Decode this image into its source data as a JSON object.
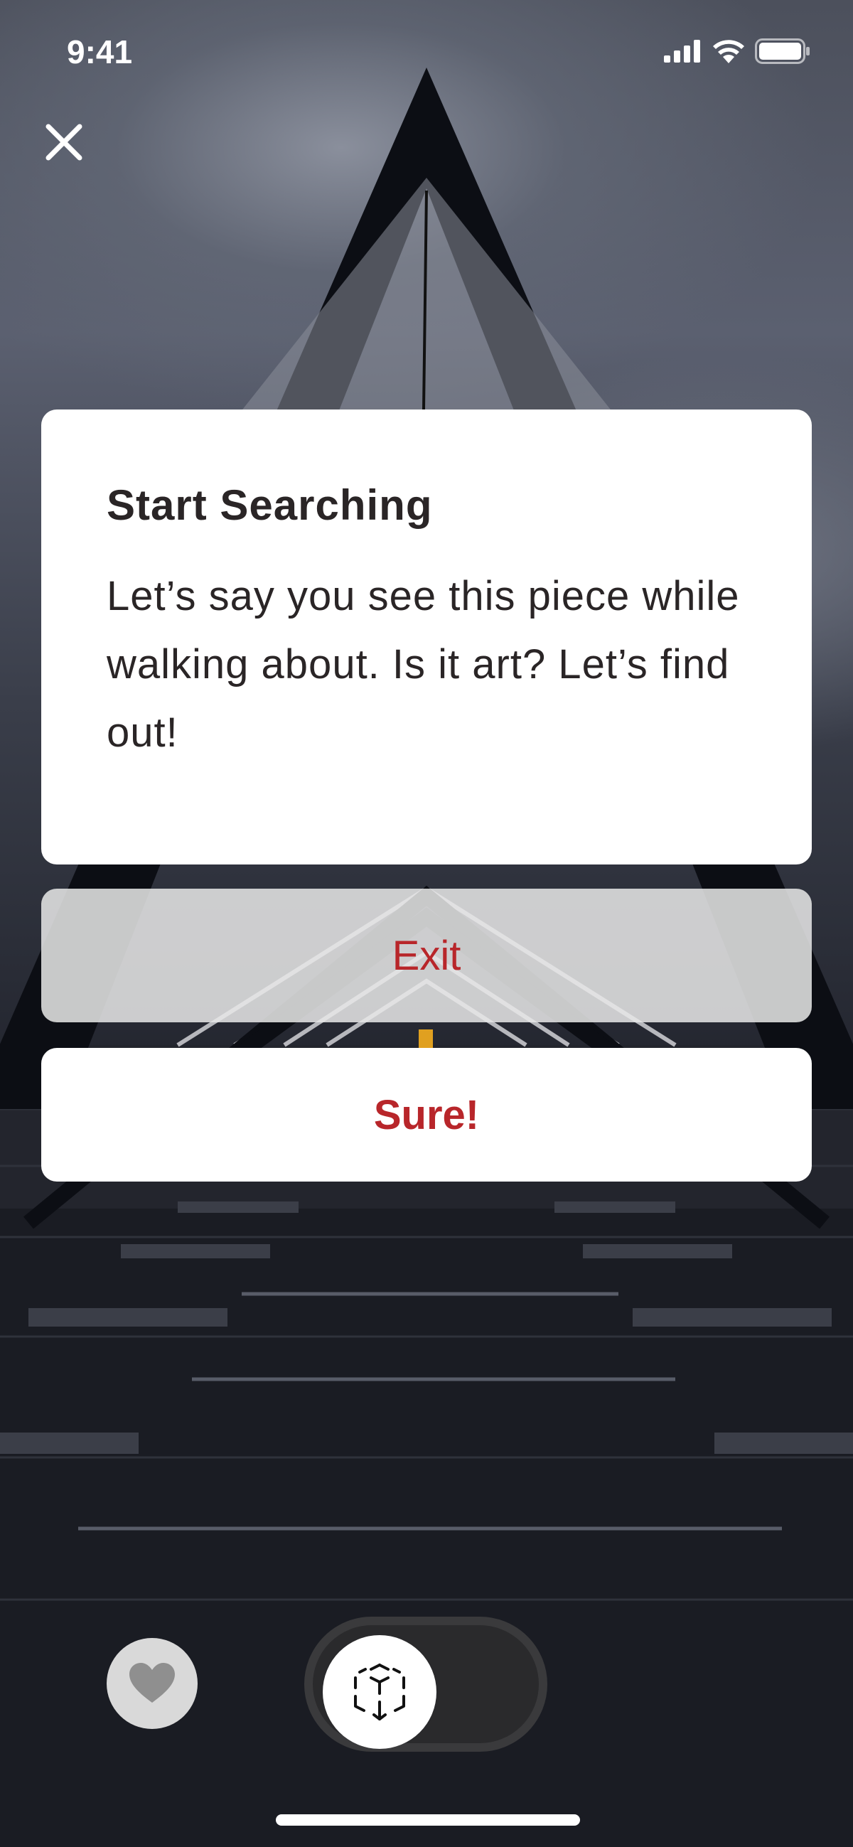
{
  "status_bar": {
    "time": "9:41",
    "icons": [
      "signal-icon",
      "wifi-icon",
      "battery-icon"
    ]
  },
  "close": {
    "icon": "close-icon"
  },
  "dialog": {
    "title": "Start Searching",
    "body": "Let’s say you see this piece while walking about. Is it art? Let’s find out!"
  },
  "actions": {
    "exit_label": "Exit",
    "sure_label": "Sure!"
  },
  "bottom_bar": {
    "favorite_icon": "heart-icon",
    "mode_toggle_icon": "ar-cube-icon"
  },
  "colors": {
    "accent_red": "#b8262a",
    "card_bg": "#ffffff",
    "text_dark": "#2a2526"
  }
}
